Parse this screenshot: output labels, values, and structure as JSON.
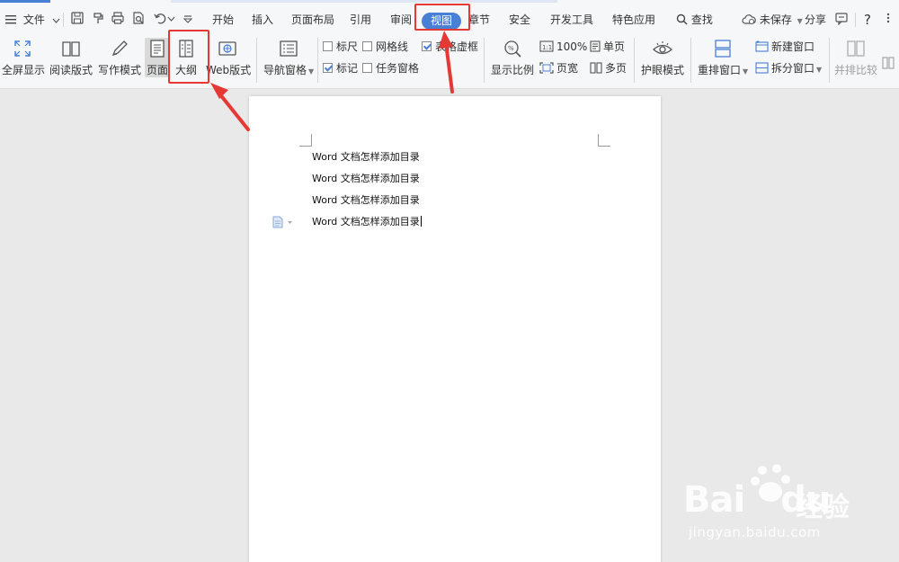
{
  "menubar": {
    "file_label": "文件",
    "tabs": [
      "开始",
      "插入",
      "页面布局",
      "引用",
      "审阅",
      "视图",
      "章节",
      "安全",
      "开发工具",
      "特色应用"
    ],
    "active_tab": "视图",
    "search_label": "查找",
    "unsaved_label": "未保存",
    "share_label": "分享",
    "help_label": "?"
  },
  "ribbon": {
    "fullscreen": "全屏显示",
    "reading": "阅读版式",
    "writing": "写作模式",
    "page": "页面",
    "outline": "大纲",
    "web": "Web版式",
    "navpane": "导航窗格",
    "ruler": "标尺",
    "gridlines": "网格线",
    "tableframe": "表格虚框",
    "marks": "标记",
    "taskpane": "任务窗格",
    "zoom": "显示比例",
    "zoom100": "100%",
    "pagewidth": "页宽",
    "onepage": "单页",
    "multipage": "多页",
    "eyecare": "护眼模式",
    "arrange": "重排窗口",
    "newwindow": "新建窗口",
    "split": "拆分窗口",
    "compare": "并排比较"
  },
  "checks": {
    "ruler": false,
    "gridlines": false,
    "tableframe": true,
    "marks": true,
    "taskpane": false
  },
  "document": {
    "lines": [
      "Word 文档怎样添加目录",
      "Word 文档怎样添加目录",
      "Word 文档怎样添加目录",
      "Word 文档怎样添加目录"
    ]
  },
  "watermark": {
    "brand": "Bai",
    "brand2": "du",
    "cn": "经验",
    "url": "jingyan.baidu.com"
  },
  "colors": {
    "accent": "#4a7fd6",
    "highlight": "#e53935"
  }
}
